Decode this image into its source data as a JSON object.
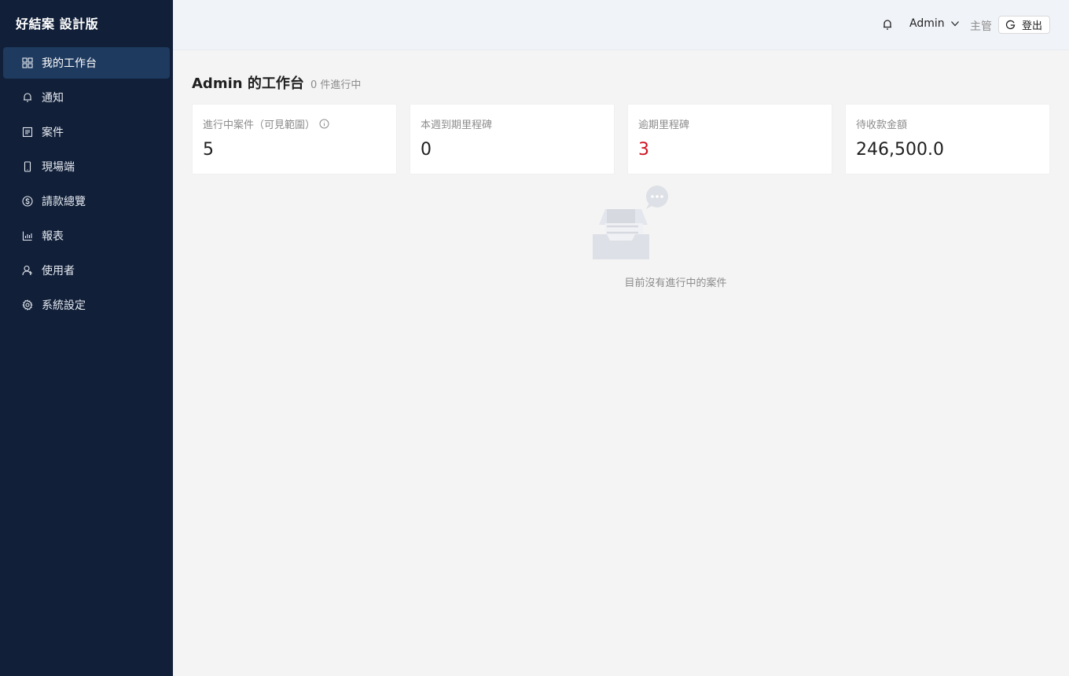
{
  "app": {
    "brand": "好結案 設計版"
  },
  "sidebar": {
    "items": [
      {
        "label": "我的工作台",
        "icon": "dashboard-icon",
        "active": true
      },
      {
        "label": "通知",
        "icon": "bell-icon"
      },
      {
        "label": "案件",
        "icon": "file-list-icon"
      },
      {
        "label": "現場端",
        "icon": "mobile-icon"
      },
      {
        "label": "請款總覽",
        "icon": "dollar-icon"
      },
      {
        "label": "報表",
        "icon": "bar-chart-icon"
      },
      {
        "label": "使用者",
        "icon": "user-icon"
      },
      {
        "label": "系統設定",
        "icon": "gear-icon"
      }
    ]
  },
  "header": {
    "user_name": "Admin",
    "role": "主管",
    "logout_label": "登出"
  },
  "main": {
    "title": "Admin 的工作台",
    "subtitle": "0 件進行中",
    "stats": [
      {
        "label": "進行中案件（可見範圍）",
        "value": "5",
        "has_info": true
      },
      {
        "label": "本週到期里程碑",
        "value": "0"
      },
      {
        "label": "逾期里程碑",
        "value": "3",
        "color": "#cf1322"
      },
      {
        "label": "待收款金額",
        "value": "246,500.0"
      }
    ],
    "empty_text": "目前沒有進行中的案件"
  },
  "colors": {
    "sidebar_bg": "#111f38",
    "sidebar_active": "#1e3a5f",
    "danger": "#cf1322"
  }
}
